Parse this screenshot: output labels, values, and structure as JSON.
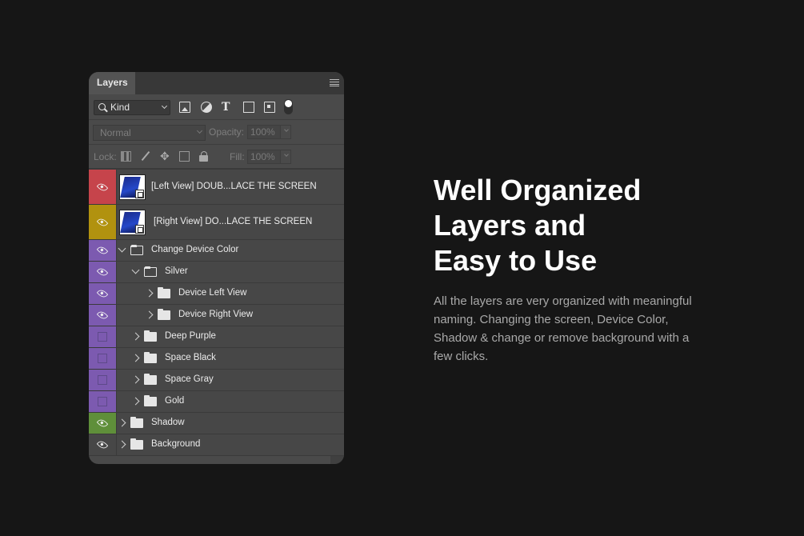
{
  "panel": {
    "tab_label": "Layers",
    "filter_kind": "Kind",
    "blend_mode": "Normal",
    "opacity_label": "Opacity:",
    "opacity_value": "100%",
    "lock_label": "Lock:",
    "fill_label": "Fill:",
    "fill_value": "100%"
  },
  "colors": {
    "red": "#c6444b",
    "yellow": "#b1920f",
    "violet": "#7c5ab0",
    "green": "#5f8f3a"
  },
  "layers": [
    {
      "name": "[Left View] DOUB...LACE THE SCREEN",
      "color": "red",
      "visible": true,
      "kind": "smart-object"
    },
    {
      "name": "[Right View] DO...LACE THE SCREEN",
      "color": "yellow",
      "visible": true,
      "kind": "smart-object"
    },
    {
      "name": "Change Device Color",
      "color": "violet",
      "visible": true,
      "kind": "group",
      "expanded": true,
      "depth": 0
    },
    {
      "name": "Silver",
      "color": "violet",
      "visible": true,
      "kind": "group",
      "expanded": true,
      "depth": 1
    },
    {
      "name": "Device Left View",
      "color": "violet",
      "visible": true,
      "kind": "group",
      "expanded": false,
      "depth": 2
    },
    {
      "name": "Device Right View",
      "color": "violet",
      "visible": true,
      "kind": "group",
      "expanded": false,
      "depth": 2
    },
    {
      "name": "Deep Purple",
      "color": "violet",
      "visible": false,
      "kind": "group",
      "expanded": false,
      "depth": 1
    },
    {
      "name": "Space Black",
      "color": "violet",
      "visible": false,
      "kind": "group",
      "expanded": false,
      "depth": 1
    },
    {
      "name": "Space Gray",
      "color": "violet",
      "visible": false,
      "kind": "group",
      "expanded": false,
      "depth": 1
    },
    {
      "name": "Gold",
      "color": "violet",
      "visible": false,
      "kind": "group",
      "expanded": false,
      "depth": 1
    },
    {
      "name": "Shadow",
      "color": "green",
      "visible": true,
      "kind": "group",
      "expanded": false,
      "depth": 0
    },
    {
      "name": "Background",
      "color": "none",
      "visible": true,
      "kind": "group",
      "expanded": false,
      "depth": 0
    }
  ],
  "promo": {
    "headline_lines": [
      "Well Organized",
      "Layers and",
      "Easy to Use"
    ],
    "description": "All the layers are very organized with meaningful naming. Changing the screen, Device Color, Shadow & change or remove background with a few clicks."
  }
}
